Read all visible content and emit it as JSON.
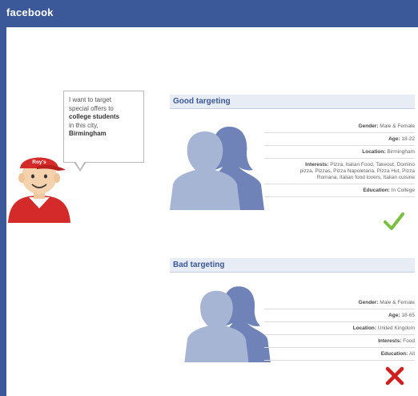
{
  "header": {
    "logo": "facebook"
  },
  "bubble": {
    "line1": "I want to target",
    "line2": "special offers to",
    "line3": "college students",
    "line4": "in this city,",
    "line5": "Birmingham"
  },
  "mascot": {
    "cap_text": "Roy's"
  },
  "good": {
    "title": "Good targeting",
    "attributes": [
      {
        "key": "Gender:",
        "value": "Male & Female"
      },
      {
        "key": "Age:",
        "value": "18-22"
      },
      {
        "key": "Location:",
        "value": "Birmingham"
      },
      {
        "key": "Interests:",
        "value": "Pizza, Italian Food, Takeout, Domino pizza, Pizzas, Pizza Napoletana, Pizza Hut, Pizza Romana, Italian food lovers, Italian cuisine"
      },
      {
        "key": "Education:",
        "value": "In College"
      }
    ],
    "verdict_icon": "checkmark-icon",
    "verdict_color": "#7ac142"
  },
  "bad": {
    "title": "Bad targeting",
    "attributes": [
      {
        "key": "Gender:",
        "value": "Male & Female"
      },
      {
        "key": "Age:",
        "value": "18-65"
      },
      {
        "key": "Location:",
        "value": "United Kingdom"
      },
      {
        "key": "Interests:",
        "value": "Food"
      },
      {
        "key": "Education:",
        "value": "All"
      }
    ],
    "verdict_icon": "cross-icon",
    "verdict_color": "#d01f1f"
  },
  "colors": {
    "brand": "#3b5998",
    "silhouette_light": "#a7b5d4",
    "silhouette_dark": "#6f83b9"
  }
}
